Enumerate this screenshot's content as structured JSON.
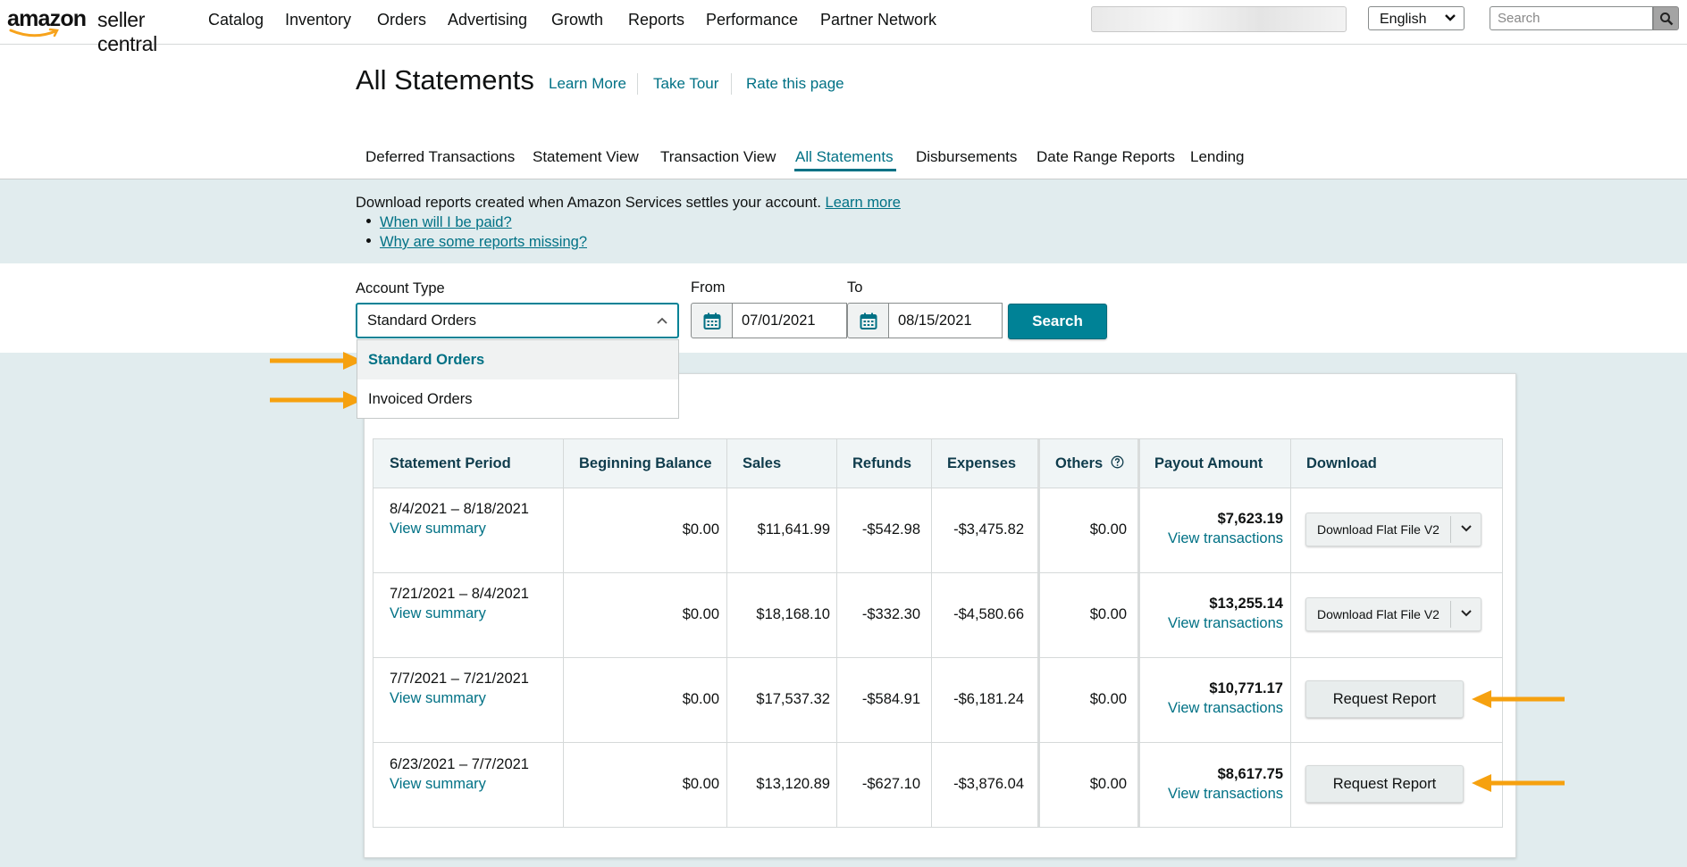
{
  "logo": {
    "word1": "amazon",
    "word2": "seller central"
  },
  "nav": [
    "Catalog",
    "Inventory",
    "Orders",
    "Advertising",
    "Growth",
    "Reports",
    "Performance",
    "Partner Network"
  ],
  "language": {
    "selected": "English"
  },
  "search": {
    "placeholder": "Search"
  },
  "header": {
    "title": "All Statements",
    "links": [
      "Learn More",
      "Take Tour",
      "Rate this page"
    ]
  },
  "tabs": [
    "Deferred Transactions",
    "Statement View",
    "Transaction View",
    "All Statements",
    "Disbursements",
    "Date Range Reports",
    "Lending"
  ],
  "active_tab": "All Statements",
  "info": {
    "text": "Download reports created when Amazon Services settles your account.",
    "learn_more": "Learn more",
    "bullets": [
      "When will I be paid?",
      "Why are some reports missing?"
    ]
  },
  "filters": {
    "account_type_label": "Account Type",
    "account_type_value": "Standard Orders",
    "options": [
      "Standard Orders",
      "Invoiced Orders"
    ],
    "from_label": "From",
    "from_value": "07/01/2021",
    "to_label": "To",
    "to_value": "08/15/2021",
    "search_label": "Search"
  },
  "table": {
    "headers": [
      "Statement Period",
      "Beginning Balance",
      "Sales",
      "Refunds",
      "Expenses",
      "Others",
      "Payout Amount",
      "Download"
    ],
    "rows": [
      {
        "period": "8/4/2021 – 8/18/2021",
        "summary": "View summary",
        "beginning": "$0.00",
        "sales": "$11,641.99",
        "refunds": "-$542.98",
        "expenses": "-$3,475.82",
        "others": "$0.00",
        "payout": "$7,623.19",
        "transactions": "View transactions",
        "download": "Download Flat File V2"
      },
      {
        "period": "7/21/2021 – 8/4/2021",
        "summary": "View summary",
        "beginning": "$0.00",
        "sales": "$18,168.10",
        "refunds": "-$332.30",
        "expenses": "-$4,580.66",
        "others": "$0.00",
        "payout": "$13,255.14",
        "transactions": "View transactions",
        "download": "Download Flat File V2"
      },
      {
        "period": "7/7/2021 – 7/21/2021",
        "summary": "View summary",
        "beginning": "$0.00",
        "sales": "$17,537.32",
        "refunds": "-$584.91",
        "expenses": "-$6,181.24",
        "others": "$0.00",
        "payout": "$10,771.17",
        "transactions": "View transactions",
        "download": "Request Report"
      },
      {
        "period": "6/23/2021 – 7/7/2021",
        "summary": "View summary",
        "beginning": "$0.00",
        "sales": "$13,120.89",
        "refunds": "-$627.10",
        "expenses": "-$3,876.04",
        "others": "$0.00",
        "payout": "$8,617.75",
        "transactions": "View transactions",
        "download": "Request Report"
      }
    ]
  },
  "colors": {
    "link": "#007185",
    "primary_button": "#008296",
    "band_bg": "#e1ecee",
    "annotation_arrow": "#f6a10f"
  }
}
